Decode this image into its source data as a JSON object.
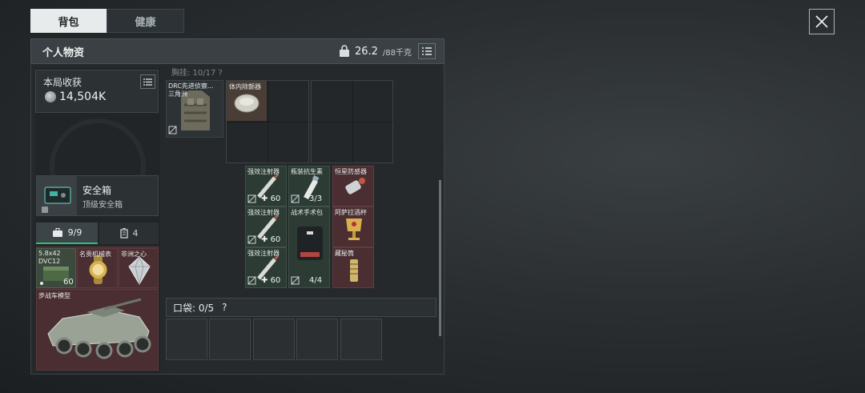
{
  "tabs": [
    {
      "label": "背包",
      "active": true
    },
    {
      "label": "健康",
      "active": false
    }
  ],
  "panel": {
    "title": "个人物资",
    "weight_value": "26.2",
    "weight_max": "/88千克"
  },
  "harvest": {
    "title": "本局收获",
    "value": "14,504K"
  },
  "top_strip": "胸挂: 10/17  ?",
  "safebox": {
    "title": "安全箱",
    "subtitle": "顶级安全箱"
  },
  "bag_tabs": {
    "slots": "9/9",
    "count": "4"
  },
  "loot": {
    "ammo_label_1": "5.8x42",
    "ammo_label_2": "DVC12",
    "ammo_count": "60",
    "watch_label": "名贵机械表",
    "gem_label": "非洲之心",
    "vehicle_label": "步战车模型"
  },
  "rig_items": {
    "vest_label_1": "DRC先进侦察...",
    "vest_label_2": "三角洲",
    "detector_label": "体内除颤器"
  },
  "items": [
    {
      "label": "强效注射器",
      "count": "60",
      "color": "#2c3b34"
    },
    {
      "label": "瓶装抗生素",
      "count": "3/3",
      "color": "#2c3b34"
    },
    {
      "label": "恒星防感器",
      "count": "",
      "color": "#4a2e31"
    },
    {
      "label": "强效注射器",
      "count": "60",
      "color": "#2c3b34"
    },
    {
      "label": "战术手术包",
      "count": "4/4",
      "color": "#2c3b34"
    },
    {
      "label": "阿萨拉酒杯",
      "count": "",
      "color": "#4a2e31"
    },
    {
      "label": "强效注射器",
      "count": "60",
      "color": "#2c3b34"
    },
    {
      "label": "藏秘筒",
      "count": "",
      "color": "#4a2e31"
    }
  ],
  "pocket": {
    "label": "口袋: ",
    "value": "0/5",
    "help": "?"
  }
}
